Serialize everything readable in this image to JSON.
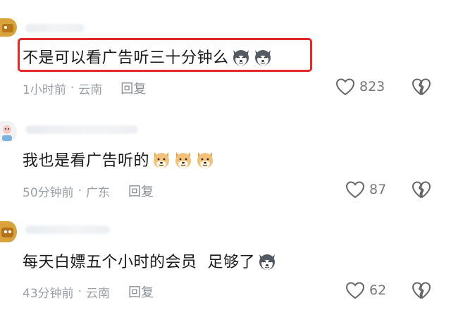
{
  "comments": [
    {
      "content": "不是可以看广告听三十分钟么",
      "emoji_name": "husky-emoji",
      "time": "1小时前",
      "sep": "·",
      "location": "云南",
      "reply_label": "回复",
      "like_count": "823"
    },
    {
      "content": "我也是看广告听的",
      "emoji_name": "doge-emoji",
      "time": "50分钟前",
      "sep": "·",
      "location": "广东",
      "reply_label": "回复",
      "like_count": "87"
    },
    {
      "content": "每天白嫖五个小时的会员  足够了",
      "emoji_name": "husky-emoji",
      "time": "43分钟前",
      "sep": "·",
      "location": "云南",
      "reply_label": "回复",
      "like_count": "62"
    }
  ],
  "colors": {
    "highlight": "#e02a2a",
    "meta": "#9aa0a6",
    "text": "#1a1a1a"
  },
  "icons": [
    "heart-outline-icon",
    "broken-heart-icon",
    "husky-emoji",
    "doge-emoji"
  ]
}
